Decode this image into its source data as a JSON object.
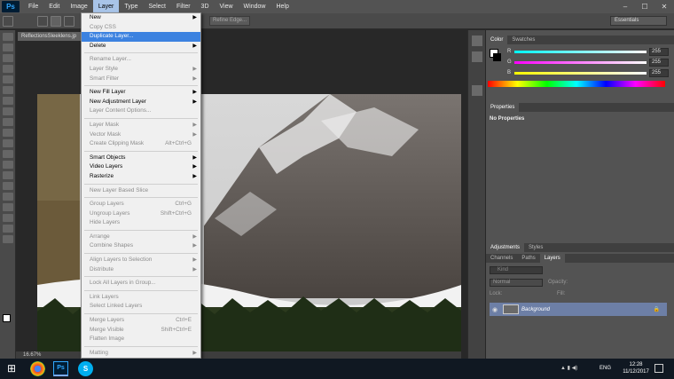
{
  "menubar": {
    "logo": "Ps",
    "items": [
      "File",
      "Edit",
      "Image",
      "Layer",
      "Type",
      "Select",
      "Filter",
      "3D",
      "View",
      "Window",
      "Help"
    ],
    "active": "Layer",
    "window_buttons": [
      "–",
      "☐",
      "✕"
    ]
  },
  "optbar": {
    "refine_edge": "Refine Edge...",
    "workspace": "Essentials"
  },
  "document": {
    "tab_title": "ReflectionsSleeklens.jp",
    "zoom": "16.67%"
  },
  "layer_menu": [
    {
      "label": "New",
      "arrow": true
    },
    {
      "label": "Copy CSS",
      "disabled": true
    },
    {
      "label": "Duplicate Layer...",
      "highlight": true
    },
    {
      "label": "Delete",
      "arrow": true
    },
    {
      "sep": true
    },
    {
      "label": "Rename Layer...",
      "disabled": true
    },
    {
      "label": "Layer Style",
      "arrow": true,
      "disabled": true
    },
    {
      "label": "Smart Filter",
      "arrow": true,
      "disabled": true
    },
    {
      "sep": true
    },
    {
      "label": "New Fill Layer",
      "arrow": true
    },
    {
      "label": "New Adjustment Layer",
      "arrow": true
    },
    {
      "label": "Layer Content Options...",
      "disabled": true
    },
    {
      "sep": true
    },
    {
      "label": "Layer Mask",
      "arrow": true,
      "disabled": true
    },
    {
      "label": "Vector Mask",
      "arrow": true,
      "disabled": true
    },
    {
      "label": "Create Clipping Mask",
      "shortcut": "Alt+Ctrl+G",
      "disabled": true
    },
    {
      "sep": true
    },
    {
      "label": "Smart Objects",
      "arrow": true
    },
    {
      "label": "Video Layers",
      "arrow": true
    },
    {
      "label": "Rasterize",
      "arrow": true
    },
    {
      "sep": true
    },
    {
      "label": "New Layer Based Slice",
      "disabled": true
    },
    {
      "sep": true
    },
    {
      "label": "Group Layers",
      "shortcut": "Ctrl+G",
      "disabled": true
    },
    {
      "label": "Ungroup Layers",
      "shortcut": "Shift+Ctrl+G",
      "disabled": true
    },
    {
      "label": "Hide Layers",
      "disabled": true
    },
    {
      "sep": true
    },
    {
      "label": "Arrange",
      "arrow": true,
      "disabled": true
    },
    {
      "label": "Combine Shapes",
      "arrow": true,
      "disabled": true
    },
    {
      "sep": true
    },
    {
      "label": "Align Layers to Selection",
      "arrow": true,
      "disabled": true
    },
    {
      "label": "Distribute",
      "arrow": true,
      "disabled": true
    },
    {
      "sep": true
    },
    {
      "label": "Lock All Layers in Group...",
      "disabled": true
    },
    {
      "sep": true
    },
    {
      "label": "Link Layers",
      "disabled": true
    },
    {
      "label": "Select Linked Layers",
      "disabled": true
    },
    {
      "sep": true
    },
    {
      "label": "Merge Layers",
      "shortcut": "Ctrl+E",
      "disabled": true
    },
    {
      "label": "Merge Visible",
      "shortcut": "Shift+Ctrl+E",
      "disabled": true
    },
    {
      "label": "Flatten Image",
      "disabled": true
    },
    {
      "sep": true
    },
    {
      "label": "Matting",
      "arrow": true,
      "disabled": true
    }
  ],
  "color_panel": {
    "tabs": [
      "Color",
      "Swatches"
    ],
    "r_label": "R",
    "g_label": "G",
    "b_label": "B",
    "r": "255",
    "g": "255",
    "b": "255"
  },
  "properties_panel": {
    "tab": "Properties",
    "empty_text": "No Properties"
  },
  "adjustments_tabs": [
    "Adjustments",
    "Styles"
  ],
  "layers_panel": {
    "tabs": [
      "Channels",
      "Paths",
      "Layers"
    ],
    "kind": "Kind",
    "blend": "Normal",
    "opacity_label": "Opacity:",
    "lock_label": "Lock:",
    "fill_label": "Fill:",
    "layer_name": "Background"
  },
  "taskbar": {
    "lang": "ENG",
    "time": "12:28",
    "date": "11/12/2017"
  },
  "colors": {
    "menu_highlight": "#3c82e0",
    "ps_blue": "#31a8ff",
    "panel": "#535353"
  }
}
